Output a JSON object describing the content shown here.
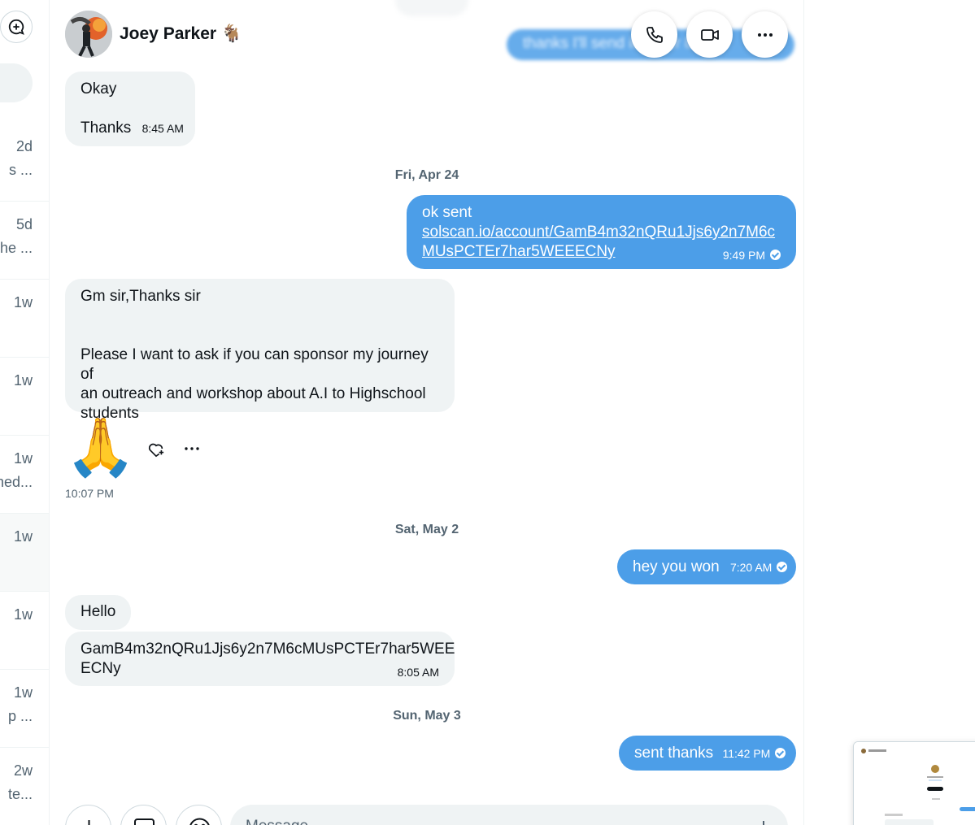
{
  "sidebar": {
    "items": [
      {
        "time": "2d",
        "snippet": "s ..."
      },
      {
        "time": "5d",
        "snippet": "he ..."
      },
      {
        "time": "1w",
        "snippet": ""
      },
      {
        "time": "1w",
        "snippet": ""
      },
      {
        "time": "1w",
        "snippet": "ned..."
      },
      {
        "time": "1w",
        "snippet": ""
      },
      {
        "time": "1w",
        "snippet": ""
      },
      {
        "time": "1w",
        "snippet": "p ..."
      },
      {
        "time": "2w",
        "snippet": "te..."
      }
    ]
  },
  "header": {
    "name": "Joey Parker 🐐",
    "ghost_text": "thanks I'll send it to her   8:1"
  },
  "messages": {
    "m1": {
      "line1": "Okay",
      "line2": "Thanks",
      "time": "8:45 AM"
    },
    "sep1": "Fri, Apr 24",
    "m2": {
      "line1": "ok sent",
      "link1": "solscan.io/account/GamB4m32nQRu1Jjs6y2n7M6c",
      "link2": "MUsPCTEr7har5WEEECNy",
      "time": "9:49 PM"
    },
    "m3": {
      "line1": "Gm sir,Thanks sir",
      "line2": "Please I want to ask if you can sponsor my journey of",
      "line3": "an outreach and workshop about A.I to Highschool",
      "line4": "students"
    },
    "m4": {
      "emoji": "🙏",
      "time": "10:07 PM"
    },
    "sep2": "Sat, May 2",
    "m5": {
      "text": "hey you won",
      "time": "7:20 AM"
    },
    "m6": {
      "text": "Hello"
    },
    "m7": {
      "line1": "GamB4m32nQRu1Jjs6y2n7M6cMUsPCTEr7har5WEE",
      "line2": "ECNy",
      "time": "8:05 AM"
    },
    "sep3": "Sun, May 3",
    "m8": {
      "text": "sent thanks",
      "time": "11:42 PM"
    }
  },
  "composer": {
    "placeholder": "Message"
  },
  "colors": {
    "accent": "#4c9ee8",
    "incoming": "#eff3f4",
    "muted": "#536471"
  }
}
